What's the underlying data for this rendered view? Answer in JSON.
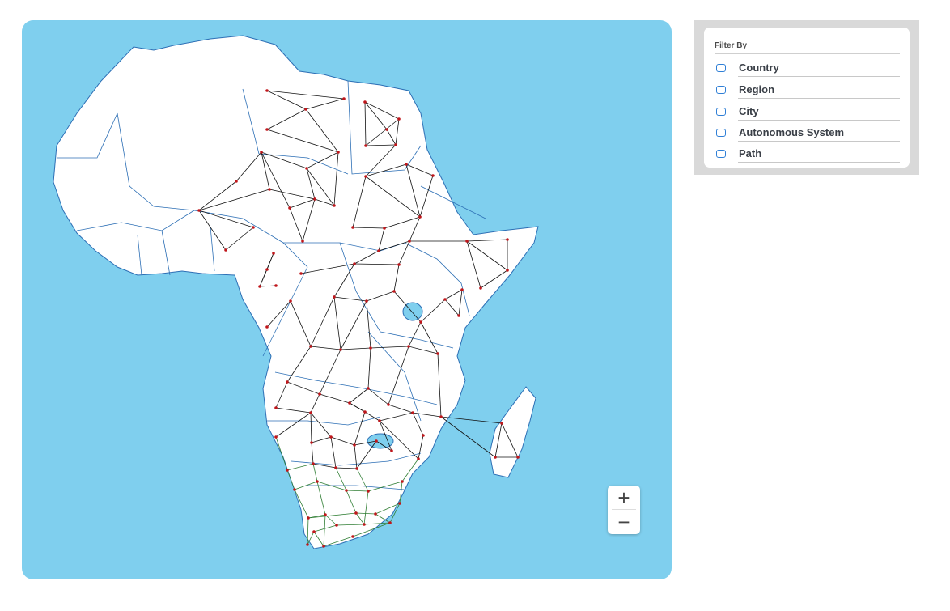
{
  "map": {
    "zoom_in_label": "+",
    "zoom_out_label": "−",
    "colors": {
      "ocean": "#7fcfee",
      "land": "#ffffff",
      "border": "#2d6fb5",
      "node": "#c0161b",
      "edge": "#111111",
      "south_edge": "#2e7d32"
    }
  },
  "filter": {
    "title": "Filter By",
    "options": [
      {
        "label": "Country",
        "checked": false
      },
      {
        "label": "Region",
        "checked": false
      },
      {
        "label": "City",
        "checked": false
      },
      {
        "label": "Autonomous System",
        "checked": false
      },
      {
        "label": "Path",
        "checked": false
      }
    ]
  }
}
